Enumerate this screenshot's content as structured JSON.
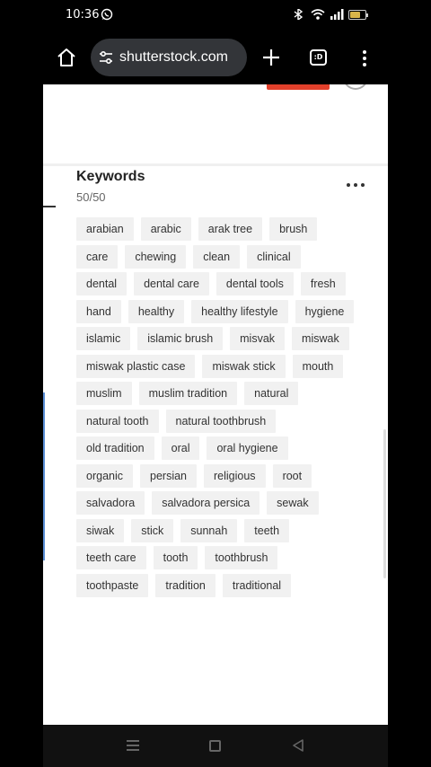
{
  "status_bar": {
    "time": "10:36",
    "battery_level": 0.7
  },
  "toolbar": {
    "url": "shutterstock.com",
    "tab_count": ":D"
  },
  "keywords": {
    "title": "Keywords",
    "count": "50/50",
    "rows": [
      [
        "arabian",
        "arabic",
        "arak tree",
        "brush"
      ],
      [
        "care",
        "chewing",
        "clean",
        "clinical"
      ],
      [
        "dental",
        "dental care",
        "dental tools",
        "fresh"
      ],
      [
        "hand",
        "healthy",
        "healthy lifestyle",
        "hygiene"
      ],
      [
        "islamic",
        "islamic brush",
        "misvak",
        "miswak"
      ],
      [
        "miswak plastic case",
        "miswak stick",
        "mouth"
      ],
      [
        "muslim",
        "muslim tradition",
        "natural"
      ],
      [
        "natural tooth",
        "natural toothbrush"
      ],
      [
        "old tradition",
        "oral",
        "oral hygiene"
      ],
      [
        "organic",
        "persian",
        "religious",
        "root"
      ],
      [
        "salvadora",
        "salvadora persica",
        "sewak"
      ],
      [
        "siwak",
        "stick",
        "sunnah",
        "teeth"
      ],
      [
        "teeth care",
        "tooth",
        "toothbrush"
      ],
      [
        "toothpaste",
        "tradition",
        "traditional"
      ]
    ]
  },
  "colors": {
    "accent_red": "#e2402b",
    "tag_bg": "#f1f1f1",
    "url_pill": "#333539"
  }
}
